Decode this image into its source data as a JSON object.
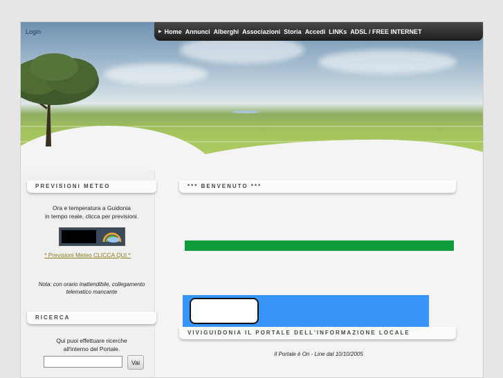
{
  "header": {
    "login_label": "Login",
    "nav": [
      "Home",
      "Annunci",
      "Alberghi",
      "Associazioni",
      "Storia",
      "Accedi",
      "LINKs",
      "ADSL / FREE INTERNET"
    ]
  },
  "sidebar": {
    "weather": {
      "title": "PREVISIONI METEO",
      "text_line1": "Ora e temperatura a Guidonia",
      "text_line2": "in tempo reale, clicca per previsioni.",
      "link_label": "* Previsioni Meteo CLICCA QUI *",
      "note": "Nota: con orario inattendibile, collegamento telematico mancante"
    },
    "search": {
      "title": "RICERCA",
      "text_line1": "Qui puoi effettuare ricerche",
      "text_line2": "all'interno del Portale.",
      "input_value": "",
      "button_label": "Vai"
    }
  },
  "main": {
    "welcome_title": "*** BENVENUTO ***",
    "portal_title": "VIVIGUIDONIA IL PORTALE DELL'INFORMAZIONE LOCALE",
    "online_note": "Il Portale è On - Line dal 10/10/2005"
  },
  "colors": {
    "nav_bg": "#1d1d1d",
    "green_bar": "#0f9a3c",
    "blue_banner": "#3896fa",
    "link": "#8a7a1a"
  }
}
